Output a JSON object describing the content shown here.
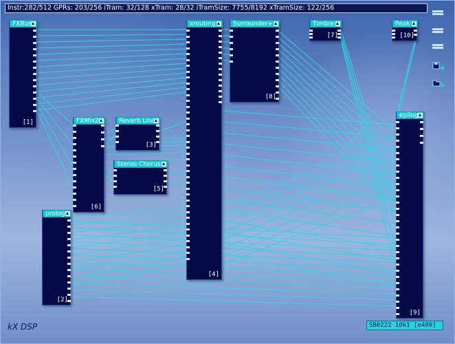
{
  "status_text": "Instr:282/512 GPRs: 203/256 iTram: 32/128 xTram: 28/32 iTramSize: 7755/8192 xTramSize: 122/256",
  "footer": {
    "brand": "kX DSP",
    "info": "SB0222 10k1 [e400]"
  },
  "blocks": [
    {
      "name": "FXBus",
      "index": "[1]"
    },
    {
      "name": "xrouting",
      "index": "[4]"
    },
    {
      "name": "Surrounder+",
      "index": "[8]"
    },
    {
      "name": "Timbre",
      "index": "[7]"
    },
    {
      "name": "Peak",
      "index": "[10]"
    },
    {
      "name": "FXMix2",
      "index": "[6]"
    },
    {
      "name": "Reverb Lite",
      "index": "[3]"
    },
    {
      "name": "Stereo Chorus",
      "index": "[5]"
    },
    {
      "name": "epilog",
      "index": "[9]"
    },
    {
      "name": "prolog",
      "index": "[2]"
    }
  ],
  "colors": {
    "block_fill": "#050a47",
    "title_bar": "#17c9d8",
    "wire": "#29d8ea",
    "status_bg": "#0a1654"
  },
  "icons": [
    "collapse-icon",
    "save-icon",
    "load-icon"
  ]
}
